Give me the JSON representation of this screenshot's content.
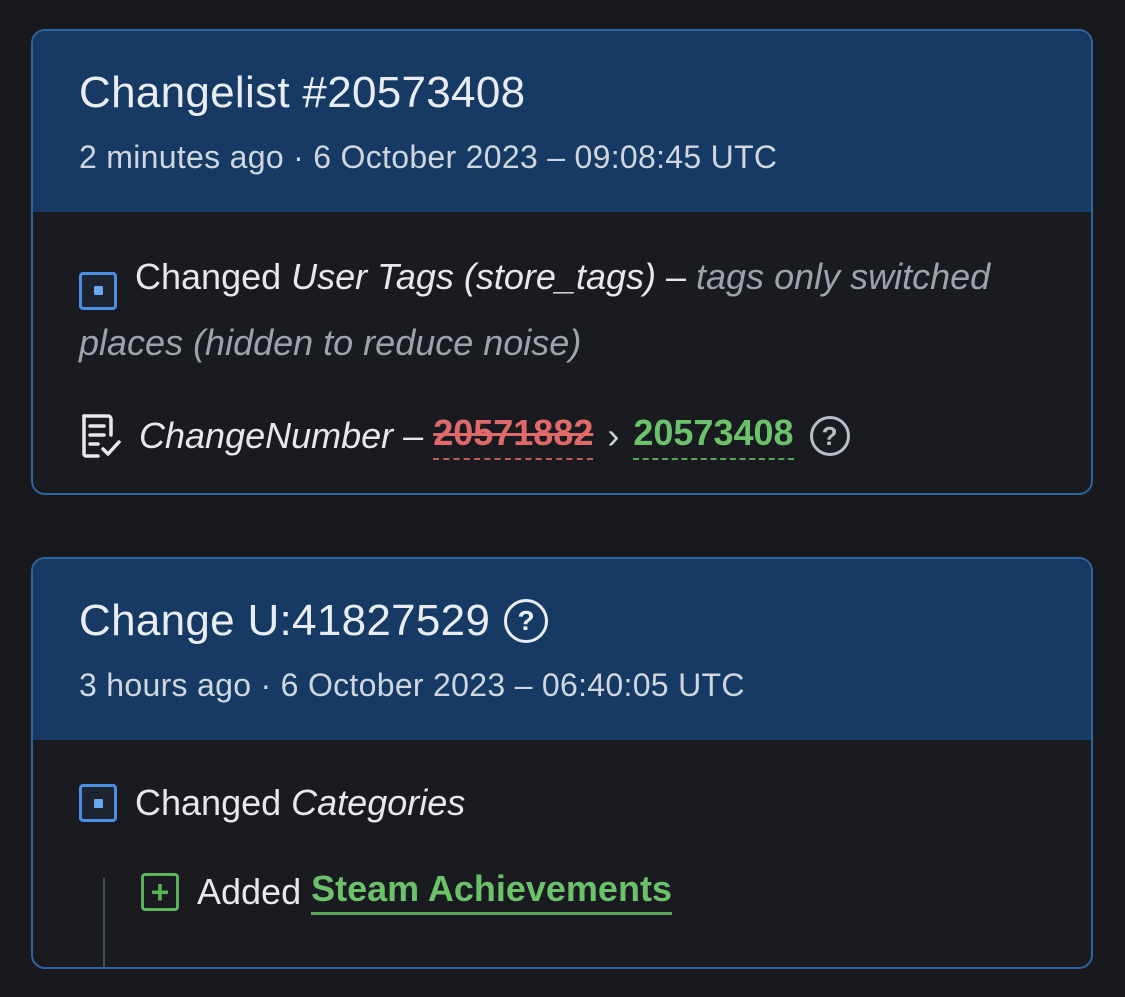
{
  "changelist": {
    "title": "Changelist #20573408",
    "subtitle": "2 minutes ago · 6 October 2023 – 09:08:45 UTC",
    "entry1": {
      "verb": "Changed",
      "field": "User Tags (store_tags)",
      "dash": " – ",
      "note": "tags only switched places (hidden to reduce noise)"
    },
    "entry2": {
      "field": "ChangeNumber",
      "dash": " – ",
      "old_value": "20571882",
      "arrow": "›",
      "new_value": "20573408"
    }
  },
  "change": {
    "title": "Change U:41827529",
    "subtitle": "3 hours ago · 6 October 2023 – 06:40:05 UTC",
    "entry1": {
      "verb": "Changed",
      "field": "Categories"
    },
    "sub_entry": {
      "verb": "Added",
      "link": "Steam Achievements"
    }
  },
  "icons": {
    "changed": "square-dot-icon",
    "number": "document-check-icon",
    "help": "question-circle-icon",
    "added": "plus-square-icon"
  },
  "colors": {
    "background": "#17191d",
    "header": "#163a63",
    "border": "#2f64a3",
    "removed": "#e06a6a",
    "added": "#6cc16b",
    "muted": "#9da3ab"
  }
}
